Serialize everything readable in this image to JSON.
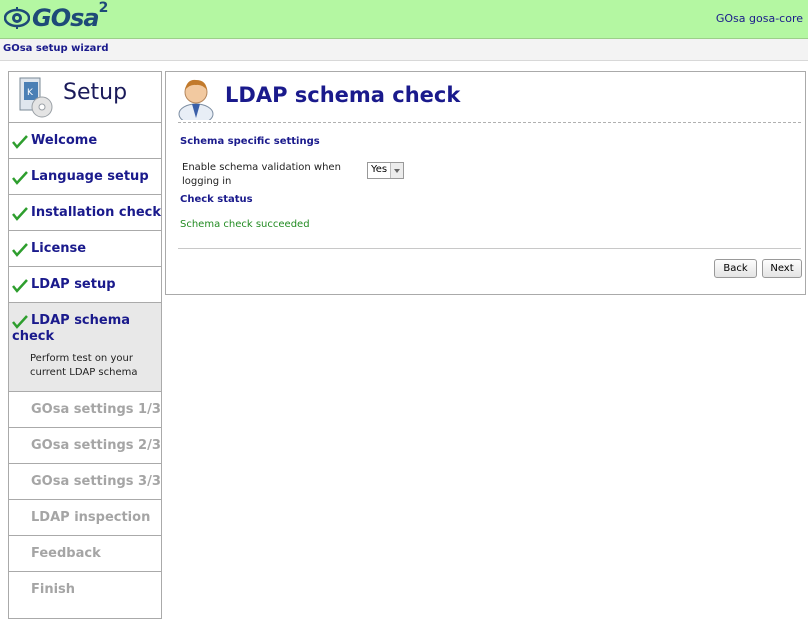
{
  "header": {
    "logo_text": "GOsa",
    "logo_sup": "2",
    "host_label": "GOsa gosa-core",
    "wizard_title": "GOsa setup wizard"
  },
  "sidebar": {
    "title": "Setup",
    "steps": [
      {
        "label": "Welcome",
        "done": true
      },
      {
        "label": "Language setup",
        "done": true
      },
      {
        "label": "Installation check",
        "done": true
      },
      {
        "label": "License",
        "done": true
      },
      {
        "label": "LDAP setup",
        "done": true
      },
      {
        "label": "LDAP schema check",
        "done": true,
        "active": true,
        "description": "Perform test on your current LDAP schema"
      },
      {
        "label": "GOsa settings 1/3",
        "done": false
      },
      {
        "label": "GOsa settings 2/3",
        "done": false
      },
      {
        "label": "GOsa settings 3/3",
        "done": false
      },
      {
        "label": "LDAP inspection",
        "done": false
      },
      {
        "label": "Feedback",
        "done": false
      },
      {
        "label": "Finish",
        "done": false
      }
    ]
  },
  "main": {
    "title": "LDAP schema check",
    "schema_section_title": "Schema specific settings",
    "validation_label": "Enable schema validation when logging in",
    "validation_value": "Yes",
    "check_section_title": "Check status",
    "check_result": "Schema check succeeded",
    "back_label": "Back",
    "next_label": "Next"
  },
  "colors": {
    "header_bg": "#b4f7a2",
    "link_blue": "#1a1a8c",
    "success_green": "#228b22",
    "check_green": "#2e9e2e",
    "disabled_gray": "#a5a5a5"
  }
}
